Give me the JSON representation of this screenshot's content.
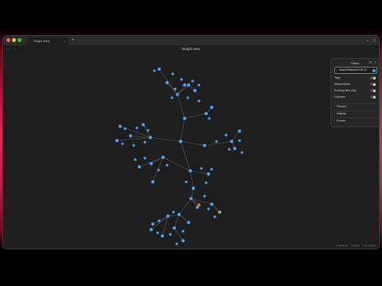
{
  "window": {
    "title": "Graph view"
  },
  "tab": {
    "label": "Graph view",
    "close": "×",
    "new_tab": "+"
  },
  "titlebar": {
    "chevron": "⌄",
    "sidebar_icon": "▯"
  },
  "nav": {
    "back": "←",
    "forward": "→",
    "more": "⋯"
  },
  "filters": {
    "title": "Filters",
    "reset_icon": "↺",
    "close_icon": "×",
    "search_value": "block:#Research OR #T",
    "search_icon": "⌕",
    "toggles": [
      {
        "label": "Tags",
        "on": true
      },
      {
        "label": "Attachments",
        "on": true
      },
      {
        "label": "Existing files only",
        "on": true
      },
      {
        "label": "Orphans",
        "on": true
      }
    ],
    "sections": [
      {
        "label": "Groups",
        "chevron": "›"
      },
      {
        "label": "Display",
        "chevron": "›"
      },
      {
        "label": "Forces",
        "chevron": "›"
      }
    ]
  },
  "status": {
    "backlinks": "0 backlinks",
    "words": "0 words",
    "chars": "0 characters"
  },
  "colors": {
    "node": "#4aa3ff",
    "node_orange": "#e0702f",
    "node_green": "#5fcf6b",
    "edge": "#5c5c5c"
  }
}
